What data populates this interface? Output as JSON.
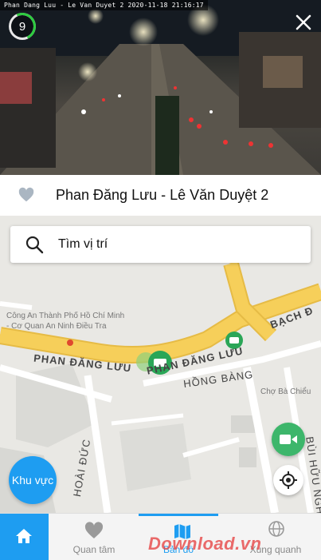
{
  "camera": {
    "overlay_text": "Phan Dang Luu - Le Van Duyet 2 2020-11-18 21:16:17",
    "countdown": "9"
  },
  "title_bar": {
    "camera_name": "Phan Đăng Lưu - Lê Văn Duyệt 2"
  },
  "search": {
    "placeholder": "Tìm vị trí"
  },
  "map": {
    "poi_police_line1": "Công An Thành Phố Hồ Chí Minh",
    "poi_police_line2": "- Cơ Quan An Ninh Điều Tra",
    "poi_market": "Chợ Bà Chiểu",
    "road_main_1": "PHAN ĐĂNG LƯU",
    "road_main_2": "PHAN ĐĂNG LƯU",
    "road_bach_dang": "BẠCH Đ",
    "road_hong_bang": "HỒNG BÀNG",
    "road_hoai_duc": "HOÀI ĐỨC",
    "road_bui_huu_nghia": "BÙI HỮU NGHĨA"
  },
  "buttons": {
    "khu_vuc": "Khu vực"
  },
  "tabs": {
    "home": "",
    "favorites": "Quan tâm",
    "map": "Bản đồ",
    "world": "Xung quanh"
  },
  "watermark": "Download.vn",
  "colors": {
    "accent": "#1e9df1",
    "camera_marker": "#2aa657",
    "road_yellow": "#f6cf5a"
  }
}
